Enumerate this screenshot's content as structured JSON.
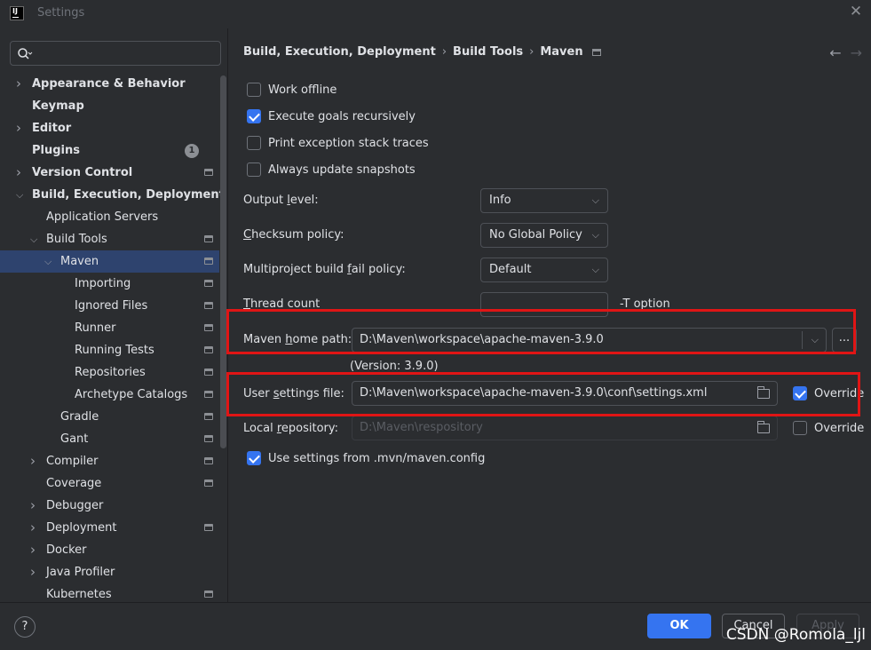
{
  "window": {
    "title": "Settings",
    "app_icon_text": "IJ"
  },
  "search": {
    "placeholder": ""
  },
  "sidebar": {
    "items": [
      {
        "label": "Appearance & Behavior",
        "bold": true,
        "chevron": "right",
        "indent": 0
      },
      {
        "label": "Keymap",
        "bold": true,
        "chevron": "",
        "indent": 0
      },
      {
        "label": "Editor",
        "bold": true,
        "chevron": "right",
        "indent": 0
      },
      {
        "label": "Plugins",
        "bold": true,
        "chevron": "",
        "indent": 0,
        "badge": "1"
      },
      {
        "label": "Version Control",
        "bold": true,
        "chevron": "right",
        "indent": 0,
        "project": true
      },
      {
        "label": "Build, Execution, Deployment",
        "bold": true,
        "chevron": "down",
        "indent": 0
      },
      {
        "label": "Application Servers",
        "bold": false,
        "chevron": "",
        "indent": 1
      },
      {
        "label": "Build Tools",
        "bold": false,
        "chevron": "down",
        "indent": 1,
        "project": true
      },
      {
        "label": "Maven",
        "bold": false,
        "chevron": "down",
        "indent": 2,
        "project": true,
        "selected": true
      },
      {
        "label": "Importing",
        "bold": false,
        "chevron": "",
        "indent": 3,
        "project": true
      },
      {
        "label": "Ignored Files",
        "bold": false,
        "chevron": "",
        "indent": 3,
        "project": true
      },
      {
        "label": "Runner",
        "bold": false,
        "chevron": "",
        "indent": 3,
        "project": true
      },
      {
        "label": "Running Tests",
        "bold": false,
        "chevron": "",
        "indent": 3,
        "project": true
      },
      {
        "label": "Repositories",
        "bold": false,
        "chevron": "",
        "indent": 3,
        "project": true
      },
      {
        "label": "Archetype Catalogs",
        "bold": false,
        "chevron": "",
        "indent": 3,
        "project": true
      },
      {
        "label": "Gradle",
        "bold": false,
        "chevron": "",
        "indent": 2,
        "project": true
      },
      {
        "label": "Gant",
        "bold": false,
        "chevron": "",
        "indent": 2,
        "project": true
      },
      {
        "label": "Compiler",
        "bold": false,
        "chevron": "right",
        "indent": 1,
        "project": true
      },
      {
        "label": "Coverage",
        "bold": false,
        "chevron": "",
        "indent": 1,
        "project": true
      },
      {
        "label": "Debugger",
        "bold": false,
        "chevron": "right",
        "indent": 1
      },
      {
        "label": "Deployment",
        "bold": false,
        "chevron": "right",
        "indent": 1,
        "project": true
      },
      {
        "label": "Docker",
        "bold": false,
        "chevron": "right",
        "indent": 1
      },
      {
        "label": "Java Profiler",
        "bold": false,
        "chevron": "right",
        "indent": 1
      },
      {
        "label": "Kubernetes",
        "bold": false,
        "chevron": "",
        "indent": 1,
        "project": true
      }
    ]
  },
  "breadcrumb": {
    "part1": "Build, Execution, Deployment",
    "part2": "Build Tools",
    "part3": "Maven",
    "sep": "›"
  },
  "nav": {
    "back": "←",
    "forward": "→"
  },
  "options": {
    "work_offline": {
      "label": "Work offline",
      "checked": false
    },
    "execute_recursively": {
      "label": "Execute goals recursively",
      "checked": true
    },
    "print_exception": {
      "label": "Print exception stack traces",
      "checked": false
    },
    "always_update": {
      "label": "Always update snapshots",
      "checked": false
    },
    "use_mvn_config": {
      "label": "Use settings from .mvn/maven.config",
      "checked": true
    }
  },
  "fields": {
    "output_level": {
      "label_pre": "Output ",
      "label_u": "l",
      "label_post": "evel:",
      "value": "Info"
    },
    "checksum_policy": {
      "label_pre": "",
      "label_u": "C",
      "label_post": "hecksum policy:",
      "value": "No Global Policy"
    },
    "multiproject": {
      "label_pre": "Multiproject build ",
      "label_u": "f",
      "label_post": "ail policy:",
      "value": "Default"
    },
    "thread_count": {
      "label_pre": "",
      "label_u": "T",
      "label_post": "hread count",
      "value": "",
      "hint": "-T option"
    },
    "maven_home": {
      "label_pre": "Maven ",
      "label_u": "h",
      "label_post": "ome path:",
      "value": "D:\\Maven\\workspace\\apache-maven-3.9.0",
      "version": "(Version: 3.9.0)",
      "browse": "..."
    },
    "user_settings": {
      "label_pre": "User ",
      "label_u": "s",
      "label_post": "ettings file:",
      "value": "D:\\Maven\\workspace\\apache-maven-3.9.0\\conf\\settings.xml",
      "override_label": "Override",
      "override_checked": true
    },
    "local_repo": {
      "label_pre": "Local ",
      "label_u": "r",
      "label_post": "epository:",
      "value": "D:\\Maven\\respository",
      "override_label": "Override",
      "override_checked": false
    }
  },
  "buttons": {
    "help": "?",
    "ok": "OK",
    "cancel": "Cancel",
    "apply": "Apply"
  },
  "watermark": "CSDN @Romola_ljl",
  "colors": {
    "accent": "#3574f0",
    "highlight_box": "#e01515",
    "selection": "#2e436e",
    "background": "#2b2d30"
  }
}
